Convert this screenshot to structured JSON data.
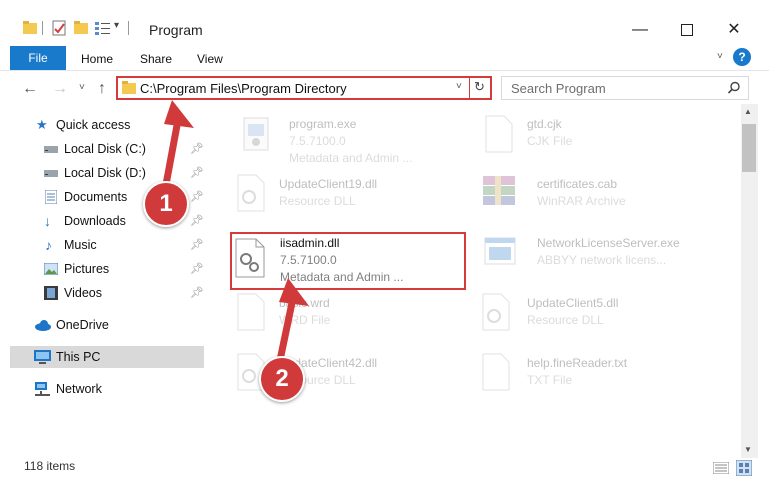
{
  "window": {
    "title": "Program",
    "minimize_icon": "minimize-icon",
    "maximize_icon": "maximize-icon",
    "close_icon": "close-icon"
  },
  "ribbon": {
    "file": "File",
    "home": "Home",
    "share": "Share",
    "view": "View"
  },
  "address": {
    "path": "C:\\Program Files\\Program Directory"
  },
  "search": {
    "placeholder": "Search Program"
  },
  "sidebar": {
    "items": [
      {
        "label": "Quick access"
      },
      {
        "label": "Local Disk (C:)"
      },
      {
        "label": "Local Disk (D:)"
      },
      {
        "label": "Documents"
      },
      {
        "label": "Downloads"
      },
      {
        "label": "Music"
      },
      {
        "label": "Pictures"
      },
      {
        "label": "Videos"
      },
      {
        "label": "OneDrive"
      },
      {
        "label": "This PC"
      },
      {
        "label": "Network"
      }
    ]
  },
  "files": [
    {
      "name": "program.exe",
      "line1": "7.5.7100.0",
      "line2": "Metadata and Admin ..."
    },
    {
      "name": "gtd.cjk",
      "line1": "CJK File",
      "line2": ""
    },
    {
      "name": "UpdateClient19.dll",
      "line1": "Resource DLL",
      "line2": ""
    },
    {
      "name": "certificates.cab",
      "line1": "WinRAR Archive",
      "line2": ""
    },
    {
      "name": "iisadmin.dll",
      "line1": "7.5.7100.0",
      "line2": "Metadata and Admin ..."
    },
    {
      "name": "NetworkLicenseServer.exe",
      "line1": "ABBYY network licens...",
      "line2": ""
    },
    {
      "name": "basic.wrd",
      "line1": "WRD File",
      "line2": ""
    },
    {
      "name": "UpdateClient5.dll",
      "line1": "Resource DLL",
      "line2": ""
    },
    {
      "name": "UpdateClient42.dll",
      "line1": "Resource DLL",
      "line2": ""
    },
    {
      "name": "help.fineReader.txt",
      "line1": "TXT File",
      "line2": ""
    }
  ],
  "status": {
    "items": "118 items"
  },
  "callouts": {
    "one": "1",
    "two": "2"
  },
  "colors": {
    "accent": "#1979ca",
    "highlight": "#d63a3a"
  }
}
